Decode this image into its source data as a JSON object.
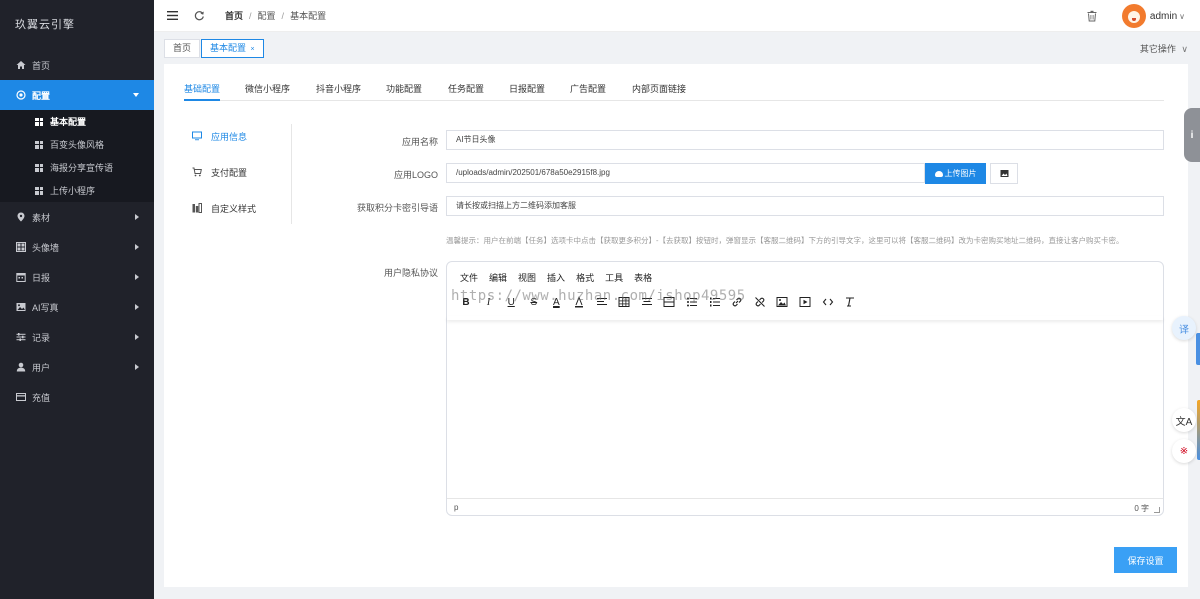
{
  "app": {
    "brand": "玖翼云引擎"
  },
  "sidebar": {
    "items": [
      {
        "label": "首页",
        "icon": "home-icon"
      },
      {
        "label": "配置",
        "icon": "settings-icon",
        "active": true,
        "expanded": true
      },
      {
        "label": "素材",
        "icon": "location-icon"
      },
      {
        "label": "头像墙",
        "icon": "grid-icon"
      },
      {
        "label": "日报",
        "icon": "calendar-icon"
      },
      {
        "label": "AI写真",
        "icon": "image-icon"
      },
      {
        "label": "记录",
        "icon": "sliders-icon"
      },
      {
        "label": "用户",
        "icon": "user-icon"
      },
      {
        "label": "充值",
        "icon": "card-icon"
      }
    ],
    "sub_items": [
      {
        "label": "基本配置",
        "active": true
      },
      {
        "label": "百变头像风格"
      },
      {
        "label": "海报分享宣传语"
      },
      {
        "label": "上传小程序"
      }
    ]
  },
  "header": {
    "breadcrumb": [
      "首页",
      "配置",
      "基本配置"
    ],
    "separator": "/",
    "user": "admin",
    "caret": "∨"
  },
  "page_tabs": {
    "home": "首页",
    "current": "基本配置",
    "current_close": "×",
    "other_ops": "其它操作"
  },
  "config_tabs": [
    "基础配置",
    "微信小程序",
    "抖音小程序",
    "功能配置",
    "任务配置",
    "日报配置",
    "广告配置",
    "内部页面链接"
  ],
  "left_menu": [
    "应用信息",
    "支付配置",
    "自定义样式"
  ],
  "form": {
    "app_name_label": "应用名称",
    "app_name_value": "AI节日头像",
    "logo_label": "应用LOGO",
    "logo_value": "/uploads/admin/202501/678a50e2915f8.jpg",
    "upload_button": "上传图片",
    "guide_label": "获取积分卡密引导语",
    "guide_value": "请长按或扫描上方二维码添加客服",
    "hint": "温馨提示：用户在前端【任务】选项卡中点击【获取更多积分】-【去获取】按钮时，弹窗显示【客服二维码】下方的引导文字，这里可以将【客服二维码】改为卡密购买地址二维码，直接让客户购买卡密。",
    "privacy_label": "用户隐私协议"
  },
  "editor": {
    "menus": [
      "文件",
      "编辑",
      "视图",
      "插入",
      "格式",
      "工具",
      "表格"
    ],
    "toolbar_icons": [
      "bold-icon",
      "italic-icon",
      "underline-icon",
      "strikethrough-icon",
      "font-color-icon",
      "highlight-color-icon",
      "align-left-icon",
      "table-icon",
      "align-center-icon",
      "align-justify-icon",
      "bullet-list-icon",
      "numbered-list-icon",
      "link-icon",
      "unlink-icon",
      "insert-image-icon",
      "insert-media-icon",
      "code-icon",
      "clear-format-icon"
    ],
    "watermark": "https://www.huzhan.com/ishop49595",
    "status_path": "p",
    "word_count": "0 字"
  },
  "save_button": "保存设置",
  "floating": {
    "info": "i",
    "translate": "译",
    "lang": "文A",
    "dots": "※"
  },
  "colors": {
    "accent": "#1e88e5",
    "sidebar_bg": "#20222a",
    "save_button": "#3aa0f5"
  }
}
